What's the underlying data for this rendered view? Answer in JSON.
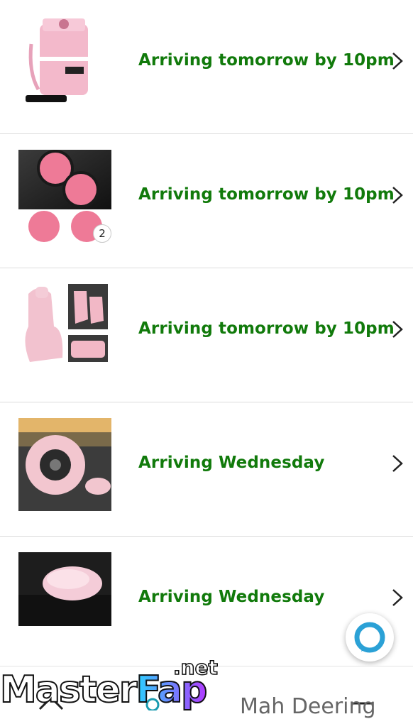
{
  "orders": [
    {
      "status": "Arriving tomorrow by 10pm",
      "product_icon": "pink-car-trash-can-icon"
    },
    {
      "status": "Arriving tomorrow by 10pm",
      "product_icon": "pink-cup-holder-coasters-icon",
      "quantity": "2"
    },
    {
      "status": "Arriving tomorrow by 10pm",
      "product_icon": "pink-car-seat-cover-icon"
    },
    {
      "status": "Arriving Wednesday",
      "product_icon": "pink-fluffy-steering-wheel-cover-icon"
    },
    {
      "status": "Arriving Wednesday",
      "product_icon": "pink-fluffy-armrest-cover-icon"
    }
  ],
  "bottom_nav": {
    "greeting_partial": "Mah Deering"
  },
  "watermark": {
    "main_a": "Master",
    "main_b": "Fap",
    "suffix": ".net"
  },
  "colors": {
    "status_green": "#117a0b",
    "divider": "#dcdcdc",
    "alexa_blue": "#2ba1d6"
  }
}
